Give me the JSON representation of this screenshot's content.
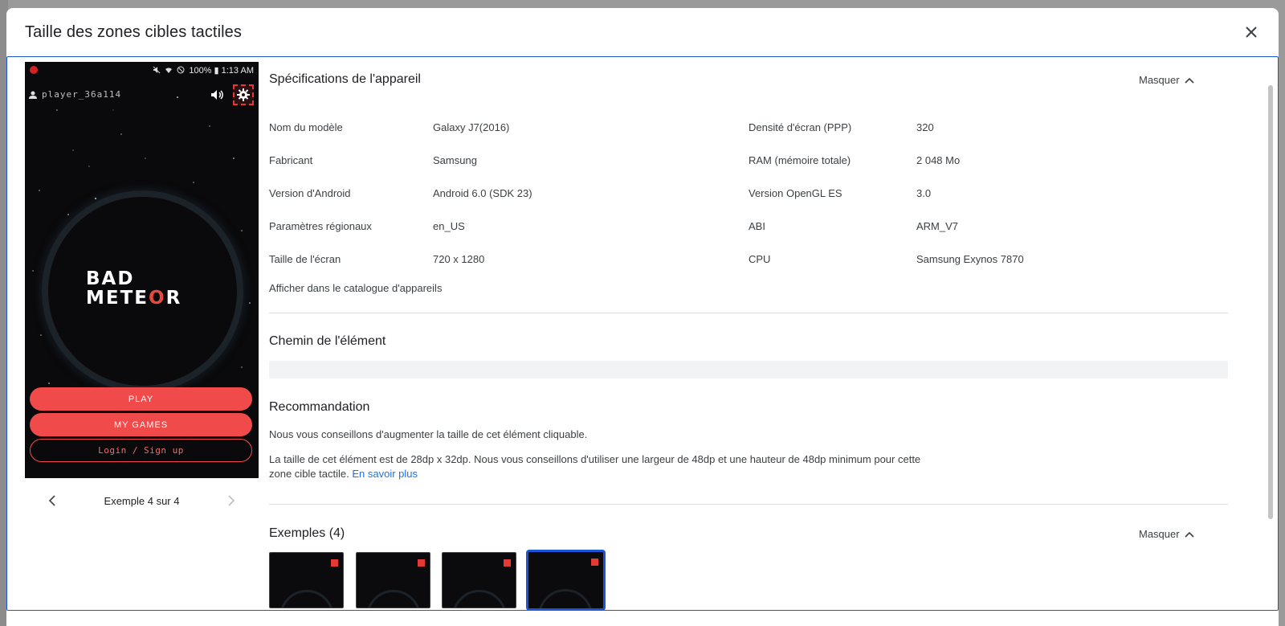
{
  "dialog": {
    "title": "Taille des zones cibles tactiles",
    "close_icon": "close-icon"
  },
  "phone": {
    "status_text": "100% ▮ 1:13 AM",
    "player_name": "player_36a114",
    "logo_line1": "BAD",
    "logo_line2_a": "METE",
    "logo_line2_o": "O",
    "logo_line2_b": "R",
    "play_label": "PLAY",
    "games_label": "MY GAMES",
    "login_label": "Login / Sign up",
    "colors": {
      "accent": "#f04a4a",
      "highlight": "#e53935"
    }
  },
  "pager": {
    "label": "Exemple 4 sur 4",
    "prev_icon": "chevron-left-icon",
    "next_icon": "chevron-right-icon"
  },
  "specs": {
    "title": "Spécifications de l'appareil",
    "collapse_label": "Masquer",
    "left": [
      {
        "label": "Nom du modèle",
        "value": "Galaxy J7(2016)"
      },
      {
        "label": "Fabricant",
        "value": "Samsung"
      },
      {
        "label": "Version d'Android",
        "value": "Android 6.0 (SDK 23)"
      },
      {
        "label": "Paramètres régionaux",
        "value": "en_US"
      },
      {
        "label": "Taille de l'écran",
        "value": "720 x 1280"
      }
    ],
    "right": [
      {
        "label": "Densité d'écran (PPP)",
        "value": "320"
      },
      {
        "label": "RAM (mémoire totale)",
        "value": "2 048 Mo"
      },
      {
        "label": "Version OpenGL ES",
        "value": "3.0"
      },
      {
        "label": "ABI",
        "value": "ARM_V7"
      },
      {
        "label": "CPU",
        "value": "Samsung Exynos 7870"
      }
    ],
    "catalog_link": "Afficher dans le catalogue d'appareils"
  },
  "path": {
    "title": "Chemin de l'élément"
  },
  "recommendation": {
    "title": "Recommandation",
    "line1": "Nous vous conseillons d'augmenter la taille de cet élément cliquable.",
    "line2a": "La taille de cet élément est de 28dp x 32dp. Nous vous conseillons d'utiliser une largeur de 48dp et une hauteur de 48dp minimum pour cette",
    "line2b": "zone cible tactile.",
    "learn_more": "En savoir plus"
  },
  "examples": {
    "title": "Exemples (4)",
    "collapse_label": "Masquer",
    "selected_index": 4
  }
}
